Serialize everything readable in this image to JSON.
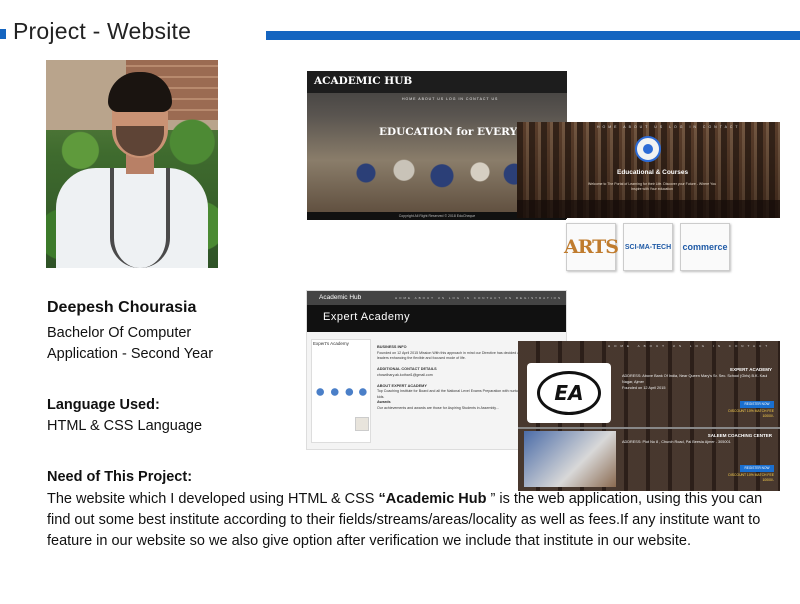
{
  "header": {
    "title": "Project - Website",
    "accent_color": "#1565c0"
  },
  "profile": {
    "photo_alt": "",
    "name": "Deepesh  Chourasia",
    "degree_line1": "Bachelor Of Computer",
    "degree_line2": "Application  - Second Year",
    "language_heading": "Language Used:",
    "language_value": "HTML & CSS  Language"
  },
  "need": {
    "heading": "Need of This Project:",
    "text_before": "The website which I   developed  using HTML & CSS  ",
    "highlight": "“Academic Hub",
    "text_after": " ” is the web application, using this you can find out some best institute according to their fields/streams/areas/locality as well as        fees.If any institute want to feature in our website so we also give option after verification we include that institute in our website."
  },
  "screenshots": {
    "shot1": {
      "brand": "ACADEMIC HUB",
      "nav": "HOME   ABOUT US   LOG IN   CONTACT US",
      "hero": "EDUCATION for EVERYONE",
      "footer": "Copyright All Right Reserved © 2018 EduCheque"
    },
    "shot2": {
      "nav": "HOME  ABOUT US  LOG IN  CONTACT",
      "label": "Educational & Courses",
      "fine": "Welcome to The Portal of Learning for their Life. Discover your Future - Where You Inspire with Your education",
      "streams": [
        "ARTS",
        "SCI-MA-TECH",
        "commerce"
      ]
    },
    "shot3": {
      "brand": "Academic Hub",
      "nav": "HOME   ABOUT US   LOG IN   CONTACT US   REGISTRATION",
      "banner": "Expert Academy",
      "card_title": "Expert's Academy",
      "business_head": "BUSINESS INFO",
      "business_text": "Founded on 12 April 2015 Mission With this approach in mind our Directive has decided also to create the future leaders enhancing the flexible and focused mode of life.",
      "contact_head": "ADDITIONAL CONTACT DETAILS",
      "contact_text": "chowdhary.ak.kothari1@gmail.com",
      "about_head": "ABOUT EXPERT ACADEMY",
      "about_text": "Top Coaching Institute for Board and all the National Level Exams Preparation with nurturing the young and creative kids.",
      "awards_head": "Awards",
      "awards_text": "Our achievements and awards are those for Aspiring Students in Assembly..."
    },
    "shot4": {
      "nav": "HOME  ABOUT US  LOG IN  CONTACT",
      "title1": "EXPERT ACADEMY",
      "address1": "ADDRESS: Above Bank Of India, Near Queen Mary's Sr. Sec. School (Girls) B.K. Kaul Nagar, Ajmer",
      "founded1": "Founded on 12 April 2015",
      "button": "REGISTER NOW",
      "discount": "DISCOUNT 10% MATCH FEE 10000/-",
      "title2": "SALEEM COACHING CENTER",
      "address2": "ADDRESS: Plot No 8 , Church Road, Pal Beesla Ajmer - 305001"
    }
  }
}
